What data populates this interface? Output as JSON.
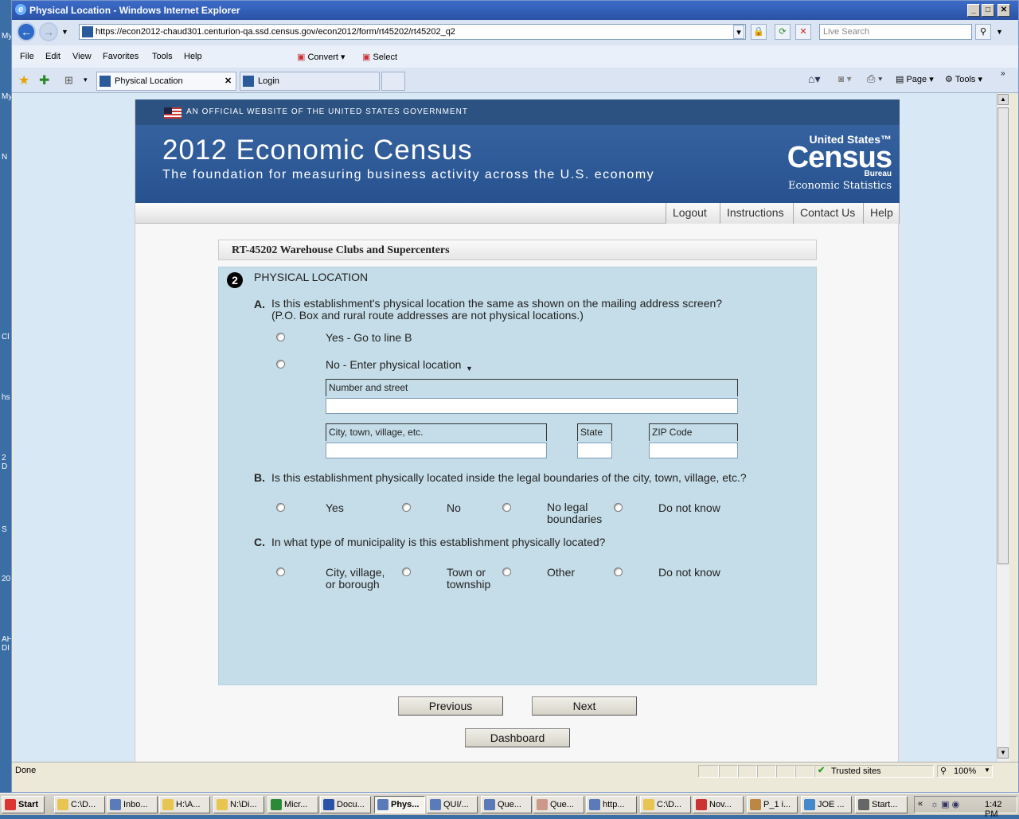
{
  "window": {
    "title": "Physical Location - Windows Internet Explorer"
  },
  "desktop_icons": [
    "My",
    "My",
    "N",
    "Cl",
    "hs",
    "2 D",
    "S",
    "20",
    "AH DI"
  ],
  "address": {
    "url": "https://econ2012-chaud301.centurion-qa.ssd.census.gov/econ2012/form/rt45202/rt45202_q2",
    "search_placeholder": "Live Search"
  },
  "menu": {
    "items": [
      "File",
      "Edit",
      "View",
      "Favorites",
      "Tools",
      "Help"
    ],
    "convert": "Convert",
    "select": "Select"
  },
  "tabs": [
    {
      "label": "Physical Location"
    },
    {
      "label": "Login"
    }
  ],
  "toolbar_right": {
    "page": "Page",
    "tools": "Tools"
  },
  "banner": {
    "official": "AN OFFICIAL WEBSITE OF THE UNITED STATES GOVERNMENT",
    "title": "2012 Economic Census",
    "subtitle": "The foundation for measuring business activity across the U.S. economy",
    "logo_line1": "United States™",
    "logo_line2": "Census",
    "logo_line3": "Bureau",
    "logo_line4": "Economic Statistics"
  },
  "nav": [
    "Logout",
    "Instructions",
    "Contact Us",
    "Help"
  ],
  "form": {
    "header": "RT-45202 Warehouse Clubs and Supercenters",
    "section_number": "2",
    "section_title": "PHYSICAL LOCATION",
    "qA": {
      "letter": "A.",
      "text": "Is this establishment's physical location the same as shown on the mailing address screen?",
      "note": "(P.O. Box and rural route addresses are not physical locations.)",
      "opt_yes": "Yes - Go to line B",
      "opt_no": "No - Enter physical location"
    },
    "fields": {
      "street": "Number and street",
      "city": "City, town, village, etc.",
      "state": "State",
      "zip": "ZIP Code"
    },
    "qB": {
      "letter": "B.",
      "text": "Is this establishment physically located inside the legal boundaries of the city, town, village, etc.?",
      "opts": [
        "Yes",
        "No",
        "No legal boundaries",
        "Do not know"
      ]
    },
    "qC": {
      "letter": "C.",
      "text": "In what type of municipality is this establishment physically located?",
      "opts": [
        "City, village, or borough",
        "Town or township",
        "Other",
        "Do not know"
      ]
    },
    "buttons": {
      "previous": "Previous",
      "next": "Next",
      "dashboard": "Dashboard"
    }
  },
  "status": {
    "text": "Done",
    "zone": "Trusted sites",
    "zoom": "100%"
  },
  "taskbar": {
    "start": "Start",
    "items": [
      "C:\\D...",
      "Inbo...",
      "H:\\A...",
      "N:\\Di...",
      "Micr...",
      "Docu...",
      "Phys...",
      "QUI/...",
      "Que...",
      "Que...",
      "http...",
      "C:\\D...",
      "Nov...",
      "P_1 i...",
      "JOE ...",
      "Start..."
    ],
    "clock": "1:42 PM"
  }
}
